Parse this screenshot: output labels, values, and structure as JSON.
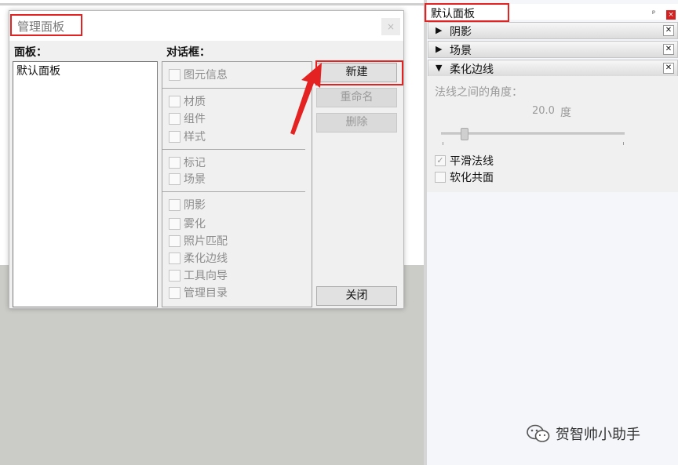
{
  "dialog": {
    "title": "管理面板",
    "close_glyph": "×",
    "panels_label": "面板：",
    "dialogs_label": "对话框：",
    "panels": [
      "默认面板"
    ],
    "dialog_items": [
      {
        "label": "图元信息",
        "checked": false
      },
      {
        "label": "材质",
        "checked": false
      },
      {
        "label": "组件",
        "checked": false
      },
      {
        "label": "样式",
        "checked": false
      },
      {
        "label": "标记",
        "checked": false
      },
      {
        "label": "场景",
        "checked": false
      },
      {
        "label": "阴影",
        "checked": false
      },
      {
        "label": "雾化",
        "checked": false
      },
      {
        "label": "照片匹配",
        "checked": false
      },
      {
        "label": "柔化边线",
        "checked": false
      },
      {
        "label": "工具向导",
        "checked": false
      },
      {
        "label": "管理目录",
        "checked": false
      }
    ],
    "buttons": {
      "new": "新建",
      "rename": "重命名",
      "delete": "删除",
      "close": "关闭"
    }
  },
  "tray": {
    "title": "默认面板",
    "pin_glyph": "ᵖ",
    "close_glyph": "×",
    "sections": [
      {
        "label": "阴影",
        "expanded": false
      },
      {
        "label": "场景",
        "expanded": false
      },
      {
        "label": "柔化边线",
        "expanded": true
      }
    ],
    "soften": {
      "angle_label": "法线之间的角度：",
      "angle_value": "20.0",
      "angle_unit": "度",
      "slider_fraction": 0.13,
      "smooth_normals_label": "平滑法线",
      "smooth_normals_checked": true,
      "soften_coplanar_label": "软化共面",
      "soften_coplanar_checked": false
    }
  },
  "watermark": {
    "text": "贺智帅小助手"
  },
  "colors": {
    "highlight": "#e52222",
    "tray_bg": "#f4f6f9"
  }
}
